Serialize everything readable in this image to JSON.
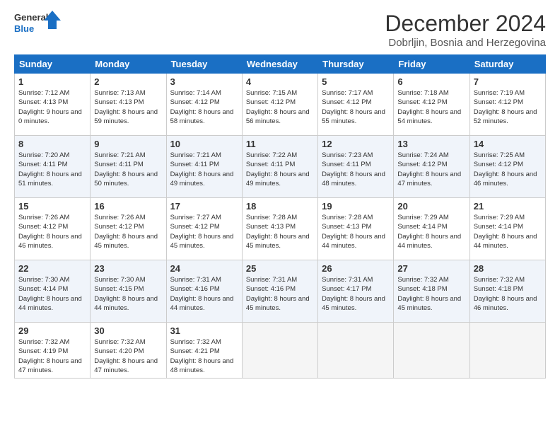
{
  "logo": {
    "line1": "General",
    "line2": "Blue"
  },
  "title": "December 2024",
  "subtitle": "Dobrljin, Bosnia and Herzegovina",
  "days_header": [
    "Sunday",
    "Monday",
    "Tuesday",
    "Wednesday",
    "Thursday",
    "Friday",
    "Saturday"
  ],
  "weeks": [
    [
      {
        "day": "1",
        "sunrise": "7:12 AM",
        "sunset": "4:13 PM",
        "daylight": "9 hours and 0 minutes."
      },
      {
        "day": "2",
        "sunrise": "7:13 AM",
        "sunset": "4:13 PM",
        "daylight": "8 hours and 59 minutes."
      },
      {
        "day": "3",
        "sunrise": "7:14 AM",
        "sunset": "4:12 PM",
        "daylight": "8 hours and 58 minutes."
      },
      {
        "day": "4",
        "sunrise": "7:15 AM",
        "sunset": "4:12 PM",
        "daylight": "8 hours and 56 minutes."
      },
      {
        "day": "5",
        "sunrise": "7:17 AM",
        "sunset": "4:12 PM",
        "daylight": "8 hours and 55 minutes."
      },
      {
        "day": "6",
        "sunrise": "7:18 AM",
        "sunset": "4:12 PM",
        "daylight": "8 hours and 54 minutes."
      },
      {
        "day": "7",
        "sunrise": "7:19 AM",
        "sunset": "4:12 PM",
        "daylight": "8 hours and 52 minutes."
      }
    ],
    [
      {
        "day": "8",
        "sunrise": "7:20 AM",
        "sunset": "4:11 PM",
        "daylight": "8 hours and 51 minutes."
      },
      {
        "day": "9",
        "sunrise": "7:21 AM",
        "sunset": "4:11 PM",
        "daylight": "8 hours and 50 minutes."
      },
      {
        "day": "10",
        "sunrise": "7:21 AM",
        "sunset": "4:11 PM",
        "daylight": "8 hours and 49 minutes."
      },
      {
        "day": "11",
        "sunrise": "7:22 AM",
        "sunset": "4:11 PM",
        "daylight": "8 hours and 49 minutes."
      },
      {
        "day": "12",
        "sunrise": "7:23 AM",
        "sunset": "4:11 PM",
        "daylight": "8 hours and 48 minutes."
      },
      {
        "day": "13",
        "sunrise": "7:24 AM",
        "sunset": "4:12 PM",
        "daylight": "8 hours and 47 minutes."
      },
      {
        "day": "14",
        "sunrise": "7:25 AM",
        "sunset": "4:12 PM",
        "daylight": "8 hours and 46 minutes."
      }
    ],
    [
      {
        "day": "15",
        "sunrise": "7:26 AM",
        "sunset": "4:12 PM",
        "daylight": "8 hours and 46 minutes."
      },
      {
        "day": "16",
        "sunrise": "7:26 AM",
        "sunset": "4:12 PM",
        "daylight": "8 hours and 45 minutes."
      },
      {
        "day": "17",
        "sunrise": "7:27 AM",
        "sunset": "4:12 PM",
        "daylight": "8 hours and 45 minutes."
      },
      {
        "day": "18",
        "sunrise": "7:28 AM",
        "sunset": "4:13 PM",
        "daylight": "8 hours and 45 minutes."
      },
      {
        "day": "19",
        "sunrise": "7:28 AM",
        "sunset": "4:13 PM",
        "daylight": "8 hours and 44 minutes."
      },
      {
        "day": "20",
        "sunrise": "7:29 AM",
        "sunset": "4:14 PM",
        "daylight": "8 hours and 44 minutes."
      },
      {
        "day": "21",
        "sunrise": "7:29 AM",
        "sunset": "4:14 PM",
        "daylight": "8 hours and 44 minutes."
      }
    ],
    [
      {
        "day": "22",
        "sunrise": "7:30 AM",
        "sunset": "4:14 PM",
        "daylight": "8 hours and 44 minutes."
      },
      {
        "day": "23",
        "sunrise": "7:30 AM",
        "sunset": "4:15 PM",
        "daylight": "8 hours and 44 minutes."
      },
      {
        "day": "24",
        "sunrise": "7:31 AM",
        "sunset": "4:16 PM",
        "daylight": "8 hours and 44 minutes."
      },
      {
        "day": "25",
        "sunrise": "7:31 AM",
        "sunset": "4:16 PM",
        "daylight": "8 hours and 45 minutes."
      },
      {
        "day": "26",
        "sunrise": "7:31 AM",
        "sunset": "4:17 PM",
        "daylight": "8 hours and 45 minutes."
      },
      {
        "day": "27",
        "sunrise": "7:32 AM",
        "sunset": "4:18 PM",
        "daylight": "8 hours and 45 minutes."
      },
      {
        "day": "28",
        "sunrise": "7:32 AM",
        "sunset": "4:18 PM",
        "daylight": "8 hours and 46 minutes."
      }
    ],
    [
      {
        "day": "29",
        "sunrise": "7:32 AM",
        "sunset": "4:19 PM",
        "daylight": "8 hours and 47 minutes."
      },
      {
        "day": "30",
        "sunrise": "7:32 AM",
        "sunset": "4:20 PM",
        "daylight": "8 hours and 47 minutes."
      },
      {
        "day": "31",
        "sunrise": "7:32 AM",
        "sunset": "4:21 PM",
        "daylight": "8 hours and 48 minutes."
      },
      null,
      null,
      null,
      null
    ]
  ]
}
